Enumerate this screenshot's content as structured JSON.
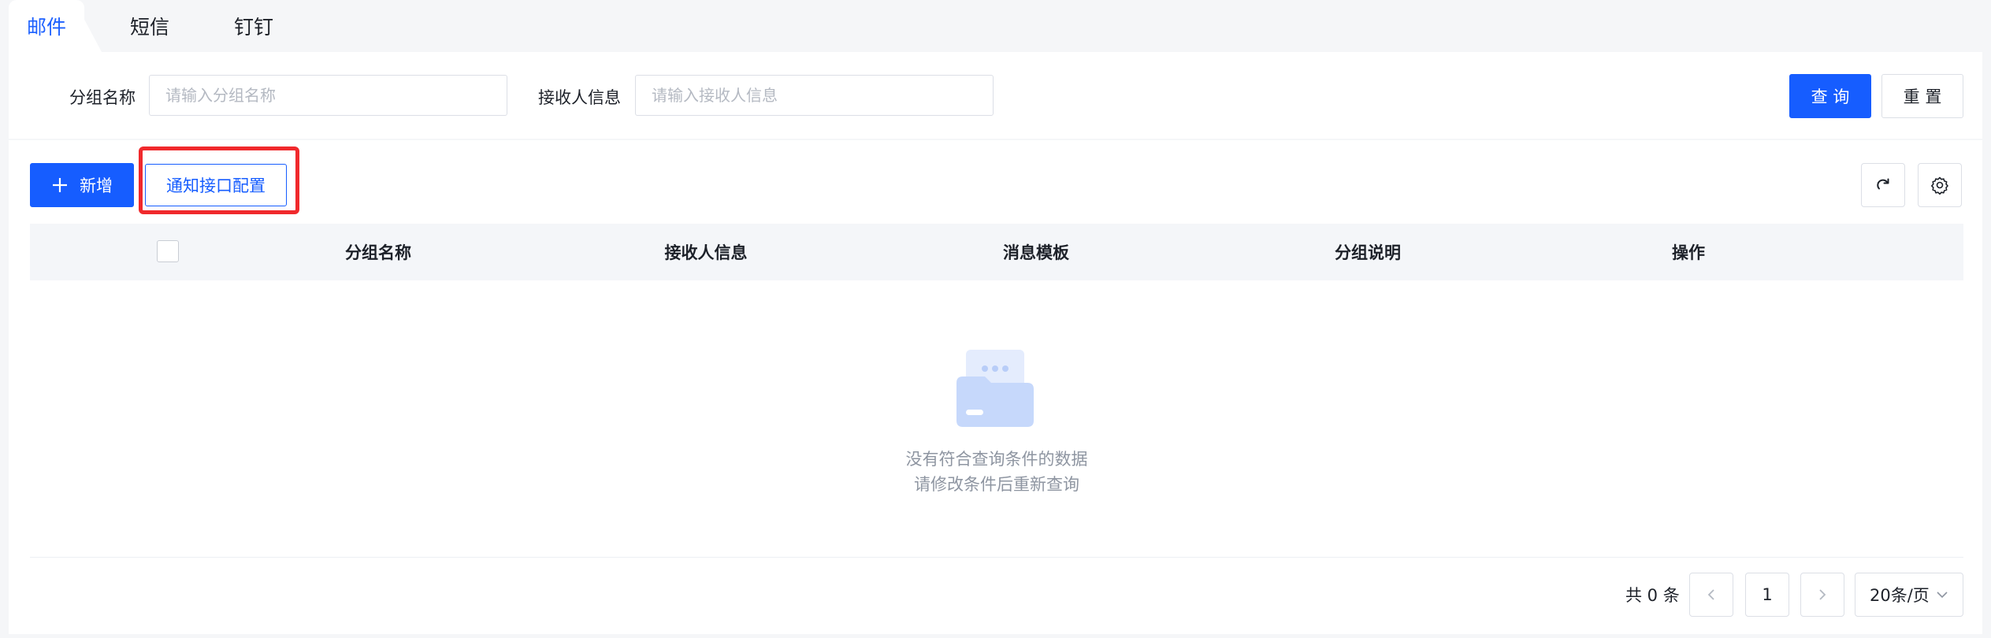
{
  "tabs": [
    {
      "label": "邮件",
      "active": true
    },
    {
      "label": "短信",
      "active": false
    },
    {
      "label": "钉钉",
      "active": false
    }
  ],
  "search": {
    "group_name_label": "分组名称",
    "group_name_placeholder": "请输入分组名称",
    "group_name_value": "",
    "receiver_label": "接收人信息",
    "receiver_placeholder": "请输入接收人信息",
    "receiver_value": "",
    "query_button": "查 询",
    "reset_button": "重 置"
  },
  "toolbar": {
    "add_icon": "plus-icon",
    "add_button": "新增",
    "config_button": "通知接口配置",
    "refresh_icon": "refresh-icon",
    "settings_icon": "gear-icon"
  },
  "table": {
    "columns": [
      "分组名称",
      "接收人信息",
      "消息模板",
      "分组说明",
      "操作"
    ],
    "rows": [],
    "empty_icon": "empty-folder-icon",
    "empty_line1": "没有符合查询条件的数据",
    "empty_line2": "请修改条件后重新查询"
  },
  "pagination": {
    "total_text": "共 0 条",
    "prev_icon": "chevron-left-icon",
    "current_page": "1",
    "next_icon": "chevron-right-icon",
    "page_size": "20条/页",
    "page_size_icon": "chevron-down-icon"
  },
  "colors": {
    "primary": "#165dff",
    "highlight": "#f0292c",
    "background": "#f5f6f8"
  }
}
